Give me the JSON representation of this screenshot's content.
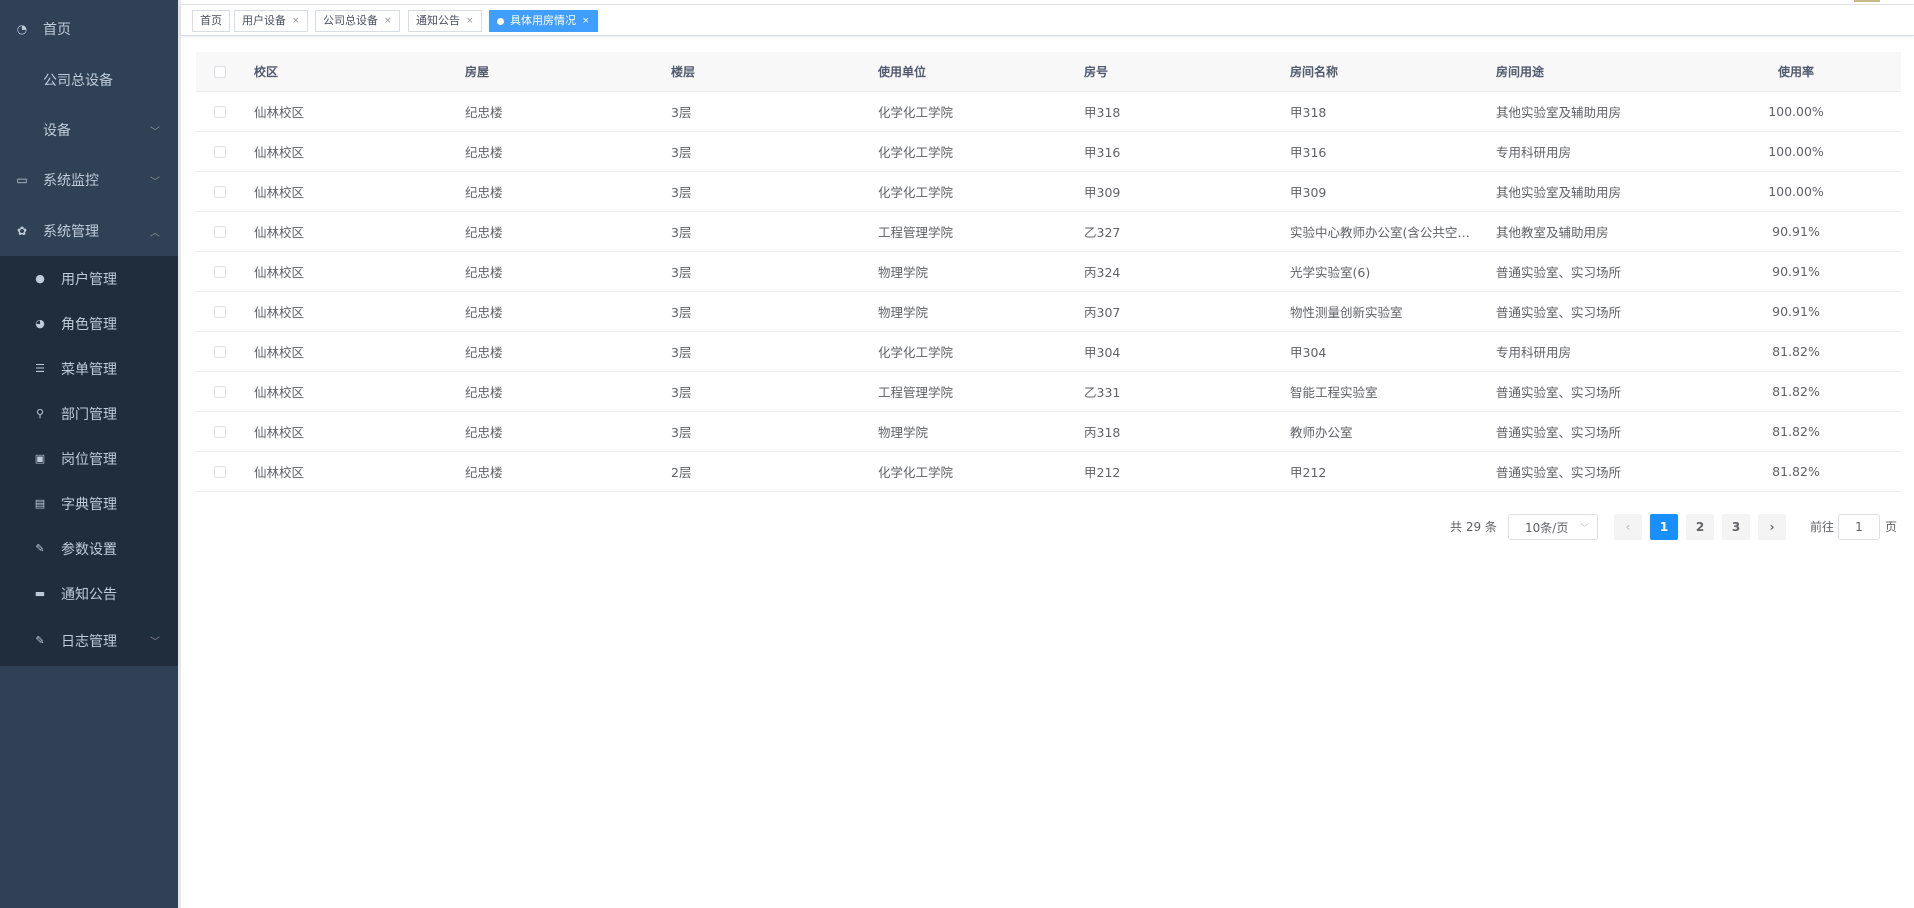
{
  "sidebar": {
    "items": [
      {
        "label": "首页",
        "icon": "dashboard-icon",
        "glyph": "◔"
      },
      {
        "label": "公司总设备"
      },
      {
        "label": "设备",
        "arrow": "﹀"
      },
      {
        "label": "系统监控",
        "icon": "monitor-icon",
        "glyph": "▭",
        "arrow": "﹀"
      },
      {
        "label": "系统管理",
        "icon": "gear-icon",
        "glyph": "✿",
        "arrow": "︿"
      }
    ],
    "submenu": [
      {
        "label": "用户管理",
        "icon": "user-icon",
        "glyph": "●"
      },
      {
        "label": "角色管理",
        "icon": "peoples-icon",
        "glyph": "◕"
      },
      {
        "label": "菜单管理",
        "icon": "tree-table-icon",
        "glyph": "☰"
      },
      {
        "label": "部门管理",
        "icon": "tree-icon",
        "glyph": "⚲"
      },
      {
        "label": "岗位管理",
        "icon": "post-icon",
        "glyph": "▣"
      },
      {
        "label": "字典管理",
        "icon": "dict-icon",
        "glyph": "▤"
      },
      {
        "label": "参数设置",
        "icon": "edit-icon",
        "glyph": "✎"
      },
      {
        "label": "通知公告",
        "icon": "message-icon",
        "glyph": "▬"
      },
      {
        "label": "日志管理",
        "icon": "log-icon",
        "glyph": "✎",
        "arrow": "﹀"
      }
    ]
  },
  "tags": [
    {
      "label": "首页"
    },
    {
      "label": "用户设备",
      "close": "×"
    },
    {
      "label": "公司总设备",
      "close": "×"
    },
    {
      "label": "通知公告",
      "close": "×"
    },
    {
      "label": "具体用房情况",
      "close": "×",
      "active": true
    }
  ],
  "table": {
    "headers": [
      "校区",
      "房屋",
      "楼层",
      "使用单位",
      "房号",
      "房间名称",
      "房间用途",
      "使用率"
    ],
    "rows": [
      [
        "仙林校区",
        "纪忠楼",
        "3层",
        "化学化工学院",
        "甲318",
        "甲318",
        "其他实验室及辅助用房",
        "100.00%"
      ],
      [
        "仙林校区",
        "纪忠楼",
        "3层",
        "化学化工学院",
        "甲316",
        "甲316",
        "专用科研用房",
        "100.00%"
      ],
      [
        "仙林校区",
        "纪忠楼",
        "3层",
        "化学化工学院",
        "甲309",
        "甲309",
        "其他实验室及辅助用房",
        "100.00%"
      ],
      [
        "仙林校区",
        "纪忠楼",
        "3层",
        "工程管理学院",
        "乙327",
        "实验中心教师办公室(含公共空…",
        "其他教室及辅助用房",
        "90.91%"
      ],
      [
        "仙林校区",
        "纪忠楼",
        "3层",
        "物理学院",
        "丙324",
        "光学实验室(6)",
        "普通实验室、实习场所",
        "90.91%"
      ],
      [
        "仙林校区",
        "纪忠楼",
        "3层",
        "物理学院",
        "丙307",
        "物性测量创新实验室",
        "普通实验室、实习场所",
        "90.91%"
      ],
      [
        "仙林校区",
        "纪忠楼",
        "3层",
        "化学化工学院",
        "甲304",
        "甲304",
        "专用科研用房",
        "81.82%"
      ],
      [
        "仙林校区",
        "纪忠楼",
        "3层",
        "工程管理学院",
        "乙331",
        "智能工程实验室",
        "普通实验室、实习场所",
        "81.82%"
      ],
      [
        "仙林校区",
        "纪忠楼",
        "3层",
        "物理学院",
        "丙318",
        "教师办公室",
        "普通实验室、实习场所",
        "81.82%"
      ],
      [
        "仙林校区",
        "纪忠楼",
        "2层",
        "化学化工学院",
        "甲212",
        "甲212",
        "普通实验室、实习场所",
        "81.82%"
      ]
    ]
  },
  "pagination": {
    "total": "共 29 条",
    "page_size": "10条/页",
    "pages": [
      "1",
      "2",
      "3"
    ],
    "current": "1",
    "prev": "‹",
    "next": "›",
    "goto_prefix": "前往",
    "goto_value": "1",
    "goto_suffix": "页"
  },
  "colors": {
    "sidebar_bg": "#304156",
    "submenu_bg": "#1f2d3d",
    "accent": "#409eff",
    "page_active": "#1890ff"
  }
}
